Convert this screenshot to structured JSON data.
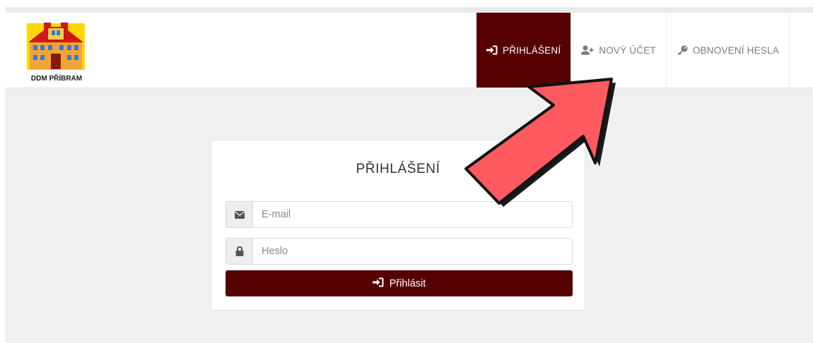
{
  "header": {
    "logo": {
      "text": "DDM PŘÍBRAM",
      "icon": "house-building-logo"
    },
    "nav": [
      {
        "label": "PŘIHLÁŠENÍ",
        "icon": "sign-in-icon",
        "active": true
      },
      {
        "label": "NOVÝ ÚČET",
        "icon": "user-plus-icon",
        "active": false
      },
      {
        "label": "OBNOVENÍ HESLA",
        "icon": "key-icon",
        "active": false
      }
    ]
  },
  "login": {
    "title": "PŘIHLÁŠENÍ",
    "email": {
      "placeholder": "E-mail",
      "value": "",
      "icon": "envelope-icon"
    },
    "password": {
      "placeholder": "Heslo",
      "value": "",
      "icon": "lock-icon"
    },
    "submit_label": "Přihlásit",
    "submit_icon": "sign-in-icon"
  },
  "annotation": {
    "icon": "red-arrow-pointer",
    "points_to": "NOVÝ ÚČET"
  },
  "colors": {
    "brand": "#560000",
    "background": "#f0f0f0",
    "annotation_arrow": "#ff5a5f"
  }
}
